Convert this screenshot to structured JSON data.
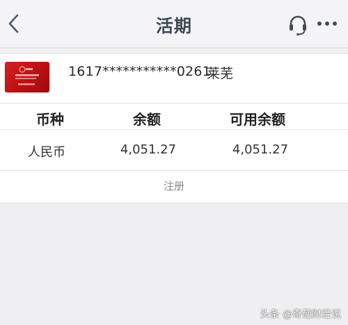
{
  "header": {
    "title": "活期",
    "back_icon": "chevron-left-icon",
    "support_icon": "headset-icon",
    "more_icon": "more-dots-icon"
  },
  "account": {
    "card_image": "bank-card-icon",
    "number": "1617***********0261",
    "holder": "莱芜"
  },
  "table": {
    "headers": [
      "币种",
      "余额",
      "可用余额"
    ],
    "rows": [
      [
        "人民币",
        "4,051.27",
        "4,051.27"
      ]
    ]
  },
  "actions": {
    "register_label": "注册"
  },
  "watermark": {
    "text": "头条 @奇葩财经说"
  },
  "colors": {
    "title": "#3b4a56",
    "card_red": "#c8161d",
    "background": "#efeff1"
  }
}
